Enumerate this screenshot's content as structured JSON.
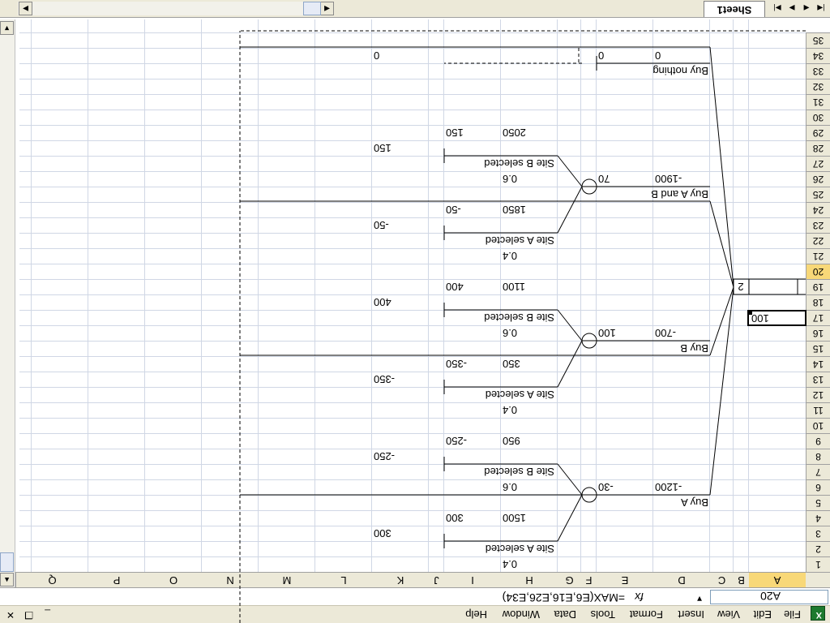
{
  "menu": {
    "items": [
      "File",
      "Edit",
      "View",
      "Insert",
      "Format",
      "Tools",
      "Data",
      "Window",
      "Help"
    ],
    "window_buttons": [
      "_",
      "❐",
      "✕"
    ]
  },
  "formula_bar": {
    "name_box": "A20",
    "fx": "fx",
    "formula": "=MAX(E6,E16,E26,E34)"
  },
  "columns": [
    "A",
    "B",
    "C",
    "D",
    "E",
    "F",
    "G",
    "H",
    "I",
    "J",
    "K",
    "L",
    "M",
    "N",
    "O",
    "P",
    "Q"
  ],
  "selected_column": "A",
  "rows": [
    "1",
    "2",
    "3",
    "4",
    "5",
    "6",
    "7",
    "8",
    "9",
    "10",
    "11",
    "12",
    "13",
    "14",
    "15",
    "16",
    "17",
    "18",
    "19",
    "20",
    "21",
    "22",
    "23",
    "24",
    "25",
    "26",
    "27",
    "28",
    "29",
    "30",
    "31",
    "32",
    "33",
    "34",
    "35"
  ],
  "selected_row": "20",
  "active_cell": {
    "ref": "A20",
    "value": "100"
  },
  "decision_node_label": "2",
  "tree": {
    "branches": [
      {
        "name": "Buy A",
        "cost": "-1200",
        "ev": "-30",
        "outcomes": [
          {
            "prob": "0.4",
            "name": "Site A selected",
            "value": "1500",
            "payoff": "300"
          },
          {
            "prob": "0.6",
            "name": "Site B selected",
            "value": "950",
            "payoff": "-250"
          }
        ]
      },
      {
        "name": "Buy B",
        "cost": "-700",
        "ev": "100",
        "outcomes": [
          {
            "prob": "0.4",
            "name": "Site A selected",
            "value": "350",
            "payoff": "-350"
          },
          {
            "prob": "0.6",
            "name": "Site B selected",
            "value": "1100",
            "payoff": "400"
          }
        ]
      },
      {
        "name": "Buy A and B",
        "cost": "-1900",
        "ev": "70",
        "outcomes": [
          {
            "prob": "0.4",
            "name": "Site A selected",
            "value": "1850",
            "payoff": "-50"
          },
          {
            "prob": "0.6",
            "name": "Site B selected",
            "value": "2050",
            "payoff": "150"
          }
        ]
      },
      {
        "name": "Buy nothing",
        "cost": "0",
        "ev": "0",
        "payoff": "0"
      }
    ]
  },
  "sheet_tabs": [
    "Sheet1"
  ],
  "tab_nav": [
    "|◀",
    "◀",
    "▶",
    "▶|"
  ]
}
